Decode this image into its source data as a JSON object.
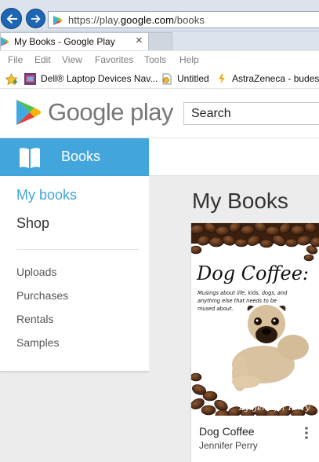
{
  "browser": {
    "url_prefix": "https://play.",
    "url_domain": "google.com",
    "url_path": "/books",
    "tab_title": "My Books - Google Play",
    "tab_close": "×",
    "menu": [
      "File",
      "Edit",
      "View",
      "Favorites",
      "Tools",
      "Help"
    ],
    "favorites": [
      {
        "label": "Dell® Laptop Devices Nav...",
        "icon": "dell-favicon"
      },
      {
        "label": "Untitled",
        "icon": "page-favicon"
      },
      {
        "label": "AstraZeneca - budeso",
        "icon": "astrazeneca-favicon"
      }
    ]
  },
  "header": {
    "logo_text": "Google play",
    "search_placeholder": "Search"
  },
  "sidebar": {
    "section_label": "Books",
    "primary": [
      {
        "label": "My books",
        "active": true
      },
      {
        "label": "Shop",
        "active": false
      }
    ],
    "secondary": [
      "Uploads",
      "Purchases",
      "Rentals",
      "Samples"
    ]
  },
  "main": {
    "title": "My Books",
    "books": [
      {
        "title": "Dog Coffee",
        "author": "Jennifer Perry",
        "cover_title": "Dog Coffee:",
        "cover_subtitle": "Musings about life, kids, dogs, and anything else that needs to be mused about.",
        "cover_author": "By: Jennifer Perry"
      }
    ]
  },
  "colors": {
    "accent": "#42a6dc",
    "browser_blue": "#1e66b5"
  }
}
